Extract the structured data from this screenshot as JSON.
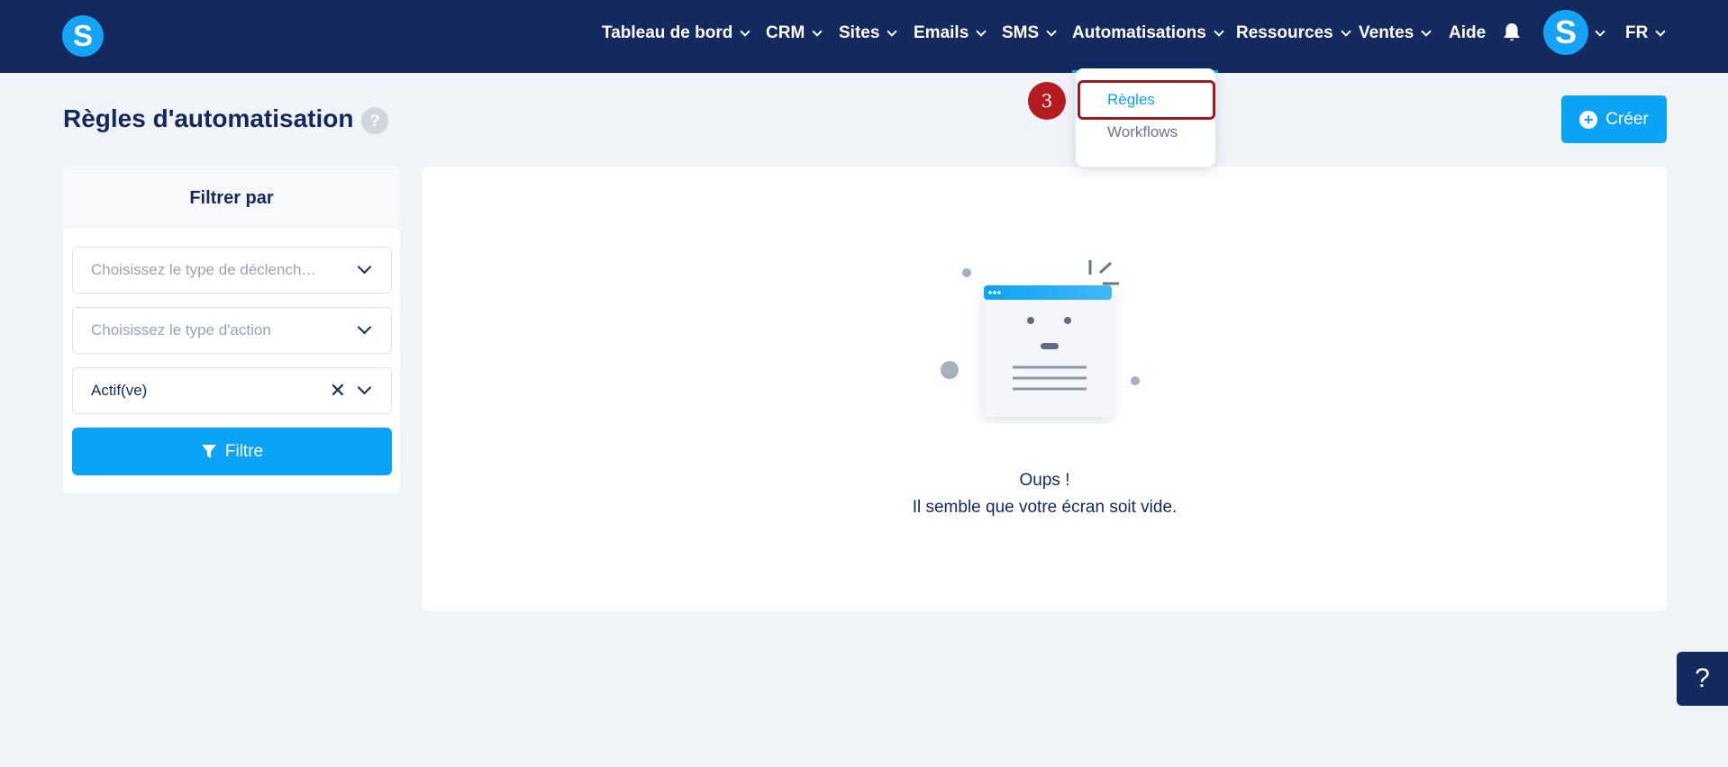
{
  "brand": {
    "logo_letter": "S",
    "accent": "#0ba3f5",
    "nav_bg": "#14295e"
  },
  "nav": {
    "items": [
      {
        "label": "Tableau de bord",
        "has_dropdown": true
      },
      {
        "label": "CRM",
        "has_dropdown": true
      },
      {
        "label": "Sites",
        "has_dropdown": true
      },
      {
        "label": "Emails",
        "has_dropdown": true
      },
      {
        "label": "SMS",
        "has_dropdown": true
      },
      {
        "label": "Automatisations",
        "has_dropdown": true,
        "active": true
      },
      {
        "label": "Ressources",
        "has_dropdown": true
      },
      {
        "label": "Ventes",
        "has_dropdown": true
      },
      {
        "label": "Aide",
        "has_dropdown": false
      }
    ],
    "notification_icon": "bell-icon",
    "avatar_letter": "S",
    "language": "FR"
  },
  "dropdown": {
    "items": [
      {
        "label": "Règles",
        "selected": true
      },
      {
        "label": "Workflows"
      }
    ],
    "step_badge": "3"
  },
  "page": {
    "title": "Règles d'automatisation",
    "help_icon": "?",
    "create_button": "Créer"
  },
  "filter": {
    "heading": "Filtrer par",
    "trigger_placeholder": "Choisissez le type de déclench…",
    "action_placeholder": "Choisissez le type d'action",
    "status_value": "Actif(ve)",
    "button_label": "Filtre"
  },
  "empty_state": {
    "line1": "Oups !",
    "line2": "Il semble que votre écran soit vide."
  },
  "help_widget": {
    "label": "?"
  }
}
